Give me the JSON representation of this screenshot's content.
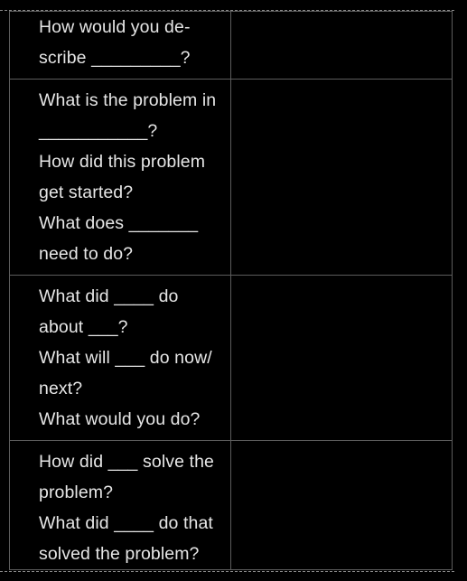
{
  "rows": [
    {
      "lines": [
        "How would you de-",
        "scribe _________?"
      ],
      "answer": ""
    },
    {
      "lines": [
        "What is the problem in",
        "___________?",
        "How did this problem",
        "get started?",
        "What does _______",
        "need to do?"
      ],
      "answer": ""
    },
    {
      "lines": [
        "What did ____ do",
        "about ___?",
        "What will ___ do now/",
        "next?",
        "What would you do?"
      ],
      "answer": ""
    },
    {
      "lines": [
        "How did ___ solve the",
        "problem?",
        "What did ____ do that",
        "solved the problem?"
      ],
      "answer": ""
    }
  ]
}
